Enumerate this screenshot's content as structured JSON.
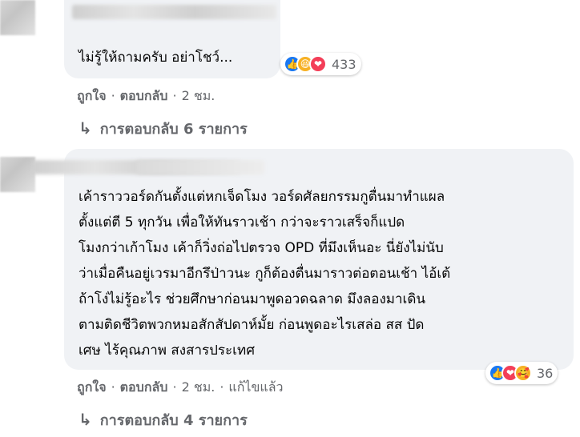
{
  "comment1": {
    "text": "ไม่รู้ให้ถามครับ อย่าโชว์...",
    "reactions": {
      "icons": [
        "like-icon",
        "haha-icon",
        "love-icon"
      ],
      "count": "433"
    },
    "actions": {
      "like": "ถูกใจ",
      "reply": "ตอบกลับ",
      "time": "2 ชม."
    },
    "replies": "การตอบกลับ 6 รายการ"
  },
  "comment2": {
    "lines": [
      "เค้าราววอร์ดกันตั้งแต่หกเจ็ดโมง วอร์ดศัลยกรรมกูตื่นมาทำแผล",
      "ตั้งแต่ตี 5 ทุกวัน เพื่อให้ทันราวเช้า กว่าจะราวเสร็จก็แปด",
      "โมงกว่าเก้าโมง เค้าก็วิ่งถ่อไปตรวจ OPD ที่มึงเห็นอะ นี่ยังไม่นับ",
      "ว่าเมื่อคืนอยู่เวรมาอีกรึป่าวนะ กูก็ต้องตื่นมาราวต่อตอนเช้า ไอ้เต้",
      "ถ้าโง่ไม่รู้อะไร ช่วยศึกษาก่อนมาพูดอวดฉลาด มึงลองมาเดิน",
      "ตามติดชีวิตพวกหมอสักสัปดาห์มั้ย ก่อนพูดอะไรเสล่อ สส ปัด",
      "เศษ ไร้คุณภาพ สงสารประเทศ"
    ],
    "reactions": {
      "icons": [
        "like-icon",
        "love-icon",
        "care-icon"
      ],
      "count": "36"
    },
    "actions": {
      "like": "ถูกใจ",
      "reply": "ตอบกลับ",
      "time": "2 ชม.",
      "edited": "แก้ไขแล้ว"
    },
    "replies": "การตอบกลับ 4 รายการ"
  },
  "colors": {
    "bubble": "#f0f2f5",
    "secondary_text": "#65676b",
    "like": "#1877f2",
    "love": "#f33e58",
    "haha": "#f7b125"
  }
}
